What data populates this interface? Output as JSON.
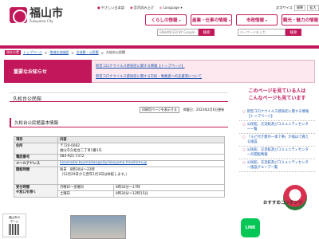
{
  "header": {
    "logo_name": "福山市",
    "logo_sub": "Fukuyama City",
    "util_links": [
      "やさしい日本語",
      "音声読み上げ",
      "Language"
    ],
    "font_size_label": "文字サイズ",
    "font_sizes": [
      "標準",
      "拡大"
    ],
    "nav": [
      "くらしの情報",
      "産業・仕事の情報",
      "市政情報",
      "観光・魅力の情報"
    ],
    "search_placeholder": "ENHANCED BY Google",
    "search_button": "検索",
    "search2_placeholder": "キーワードを入力",
    "search2_button": "検索"
  },
  "breadcrumb": {
    "here": "現在位置",
    "items": [
      "トップページ",
      "地域交流施設",
      "交流館・公民館",
      "久松台公民館"
    ]
  },
  "notice": {
    "label": "重要なお知らせ",
    "items": [
      "新型コロナウイルス感染症に関する情報【トップページ】",
      "新型コロナウイルス感染症に関する市民・事業者への支援等について"
    ]
  },
  "page": {
    "title": "久松台公民館",
    "tools": [
      "印刷用ページを表示する",
      "掲載日：2023年2月6日更新"
    ],
    "section_title": "久松台公民館基本情報",
    "table": {
      "header": [
        "項目",
        "内容"
      ],
      "rows": [
        {
          "label": "住所",
          "value": "〒720-0082\n福山市久松台二丁目1番1号"
        },
        {
          "label": "電話番号",
          "value": "084-921-7372"
        },
        {
          "label": "メールアドレス",
          "value": "hisamadai-kouminkan@city.fukuyama.hiroshima.jp"
        },
        {
          "label": "開館時間",
          "value": "毎日　8時30分～22時\n（12月29日から翌年1月3日は休館します。）"
        },
        {
          "label": "受付時間\n※窓口を除く",
          "value_a": "月曜日～金曜日",
          "value_b": "8時30分～17時"
        },
        {
          "label": "",
          "value_a": "土曜日",
          "value_b": "8時30分～12時15分"
        }
      ]
    }
  },
  "sidebar": {
    "heading_line1": "このページを見ている人は",
    "heading_line2": "こんなページも見ています",
    "items": [
      "新型コロナウイルス感染症に関する情報【トップページ】",
      "公民館、交流館及びコミュニティセンター一覧",
      "「ルビ付き雑巾一本で事」が福山で買える施設",
      "公民館、交流館及びコミュニティセンターの開館情報",
      "公民館、交流館及びコミュニティセンター施設グループ一覧"
    ],
    "recommend": "おすすめコンテンツ",
    "line_label": "LINE"
  },
  "qr_label": "福山市の\nホーム"
}
